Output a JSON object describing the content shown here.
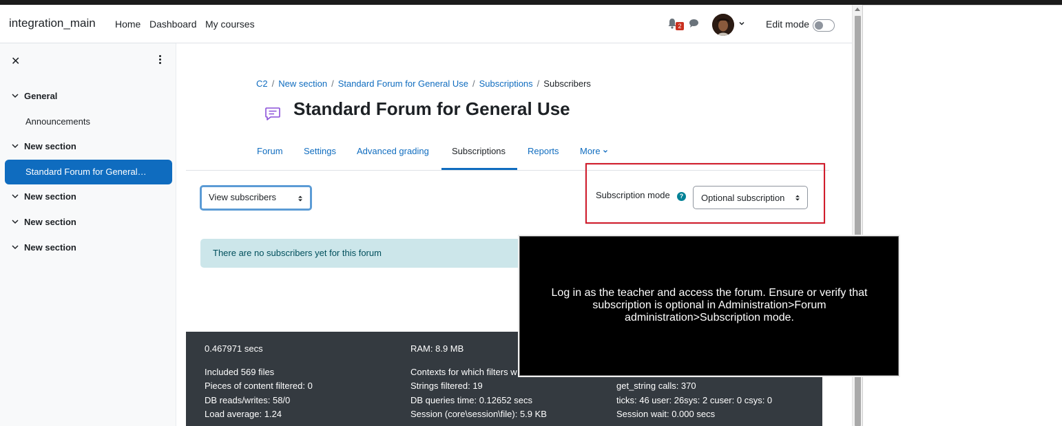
{
  "navbar": {
    "site_name": "integration_main",
    "links": [
      "Home",
      "Dashboard",
      "My courses"
    ],
    "notification_count": "2",
    "edit_mode_label": "Edit mode"
  },
  "drawer": {
    "items": [
      {
        "type": "section",
        "label": "General"
      },
      {
        "type": "activity",
        "label": "Announcements"
      },
      {
        "type": "section",
        "label": "New section"
      },
      {
        "type": "activity",
        "label": "Standard Forum for General…",
        "active": true
      },
      {
        "type": "section",
        "label": "New section"
      },
      {
        "type": "section",
        "label": "New section"
      },
      {
        "type": "section",
        "label": "New section"
      }
    ]
  },
  "breadcrumb": [
    "C2",
    "New section",
    "Standard Forum for General Use",
    "Subscriptions",
    "Subscribers"
  ],
  "page": {
    "title": "Standard Forum for General Use"
  },
  "tabs": [
    "Forum",
    "Settings",
    "Advanced grading",
    "Subscriptions",
    "Reports",
    "More"
  ],
  "active_tab": "Subscriptions",
  "view_select": {
    "value": "View subscribers"
  },
  "subscription": {
    "label": "Subscription mode",
    "help": "?",
    "value": "Optional subscription"
  },
  "alert": {
    "text": "There are no subscribers yet for this forum"
  },
  "footer": {
    "col1": [
      "0.467971 secs",
      "Included 569 files",
      "Pieces of content filtered: 0",
      "DB reads/writes: 58/0",
      "Load average: 1.24"
    ],
    "col2": [
      "RAM: 8.9 MB",
      "Contexts for which filters w",
      "Strings filtered: 19",
      "DB queries time: 0.12652 secs",
      "Session (core\\session\\file): 5.9 KB"
    ],
    "col3": [
      "get_string calls: 370",
      "ticks: 46 user: 26sys: 2 cuser: 0 csys: 0",
      "Session wait: 0.000 secs"
    ]
  },
  "overlay": {
    "text": "Log in as the teacher and access the forum. Ensure or verify that subscription is optional in Administration>Forum administration>Subscription mode."
  },
  "colors": {
    "primary": "#0f6cbf",
    "alert_bg": "#cce6ea",
    "footer_bg": "#343a40",
    "highlight_red": "#d11a2a",
    "badge_red": "#ca3120"
  }
}
